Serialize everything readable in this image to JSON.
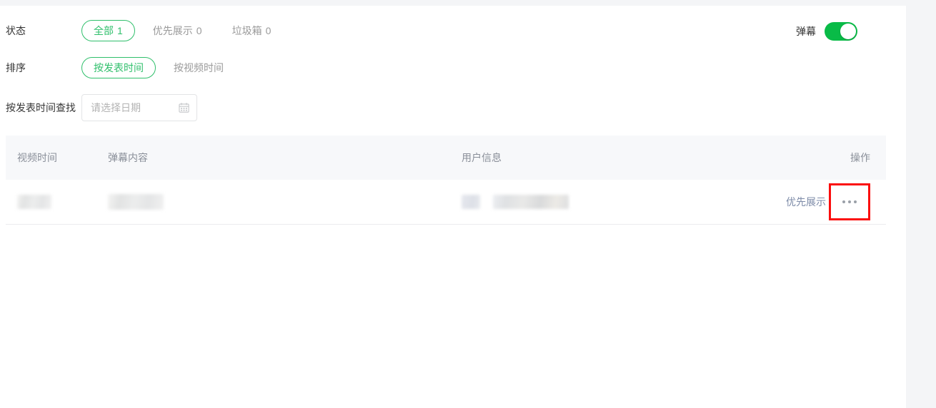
{
  "page": {
    "accent_green": "#2fbf6b",
    "switch_on_color": "#09bb47",
    "highlight_color": "#fb0d0d",
    "muted_text_color": "#9a9a9a",
    "header_bg": "#f7f8fa",
    "gutter_bg": "#f4f5f7"
  },
  "filters": {
    "status": {
      "label": "状态",
      "tabs": [
        {
          "name": "all",
          "label": "全部",
          "count": "1",
          "active": true
        },
        {
          "name": "priority",
          "label": "优先展示",
          "count": "0",
          "active": false
        },
        {
          "name": "trash",
          "label": "垃圾箱",
          "count": "0",
          "active": false
        }
      ]
    },
    "sort": {
      "label": "排序",
      "tabs": [
        {
          "name": "by-publish-time",
          "label": "按发表时间",
          "active": true
        },
        {
          "name": "by-video-time",
          "label": "按视频时间",
          "active": false
        }
      ]
    },
    "date_search": {
      "label": "按发表时间查找",
      "placeholder": "请选择日期",
      "value": "",
      "icon": "calendar-icon"
    }
  },
  "danmu_switch": {
    "label": "弹幕",
    "state": "on"
  },
  "table": {
    "columns": [
      {
        "name": "video-time",
        "label": "视频时间"
      },
      {
        "name": "danmu-content",
        "label": "弹幕内容"
      },
      {
        "name": "user-info",
        "label": "用户信息"
      },
      {
        "name": "operations",
        "label": "操作"
      }
    ],
    "rows": [
      {
        "video_time": "",
        "danmu_content": "",
        "user_avatar": "",
        "user_name": "",
        "operations": {
          "primary_label": "优先展示",
          "more_label": "···",
          "more_icon": "ellipsis-icon",
          "highlighted": true
        }
      }
    ]
  }
}
